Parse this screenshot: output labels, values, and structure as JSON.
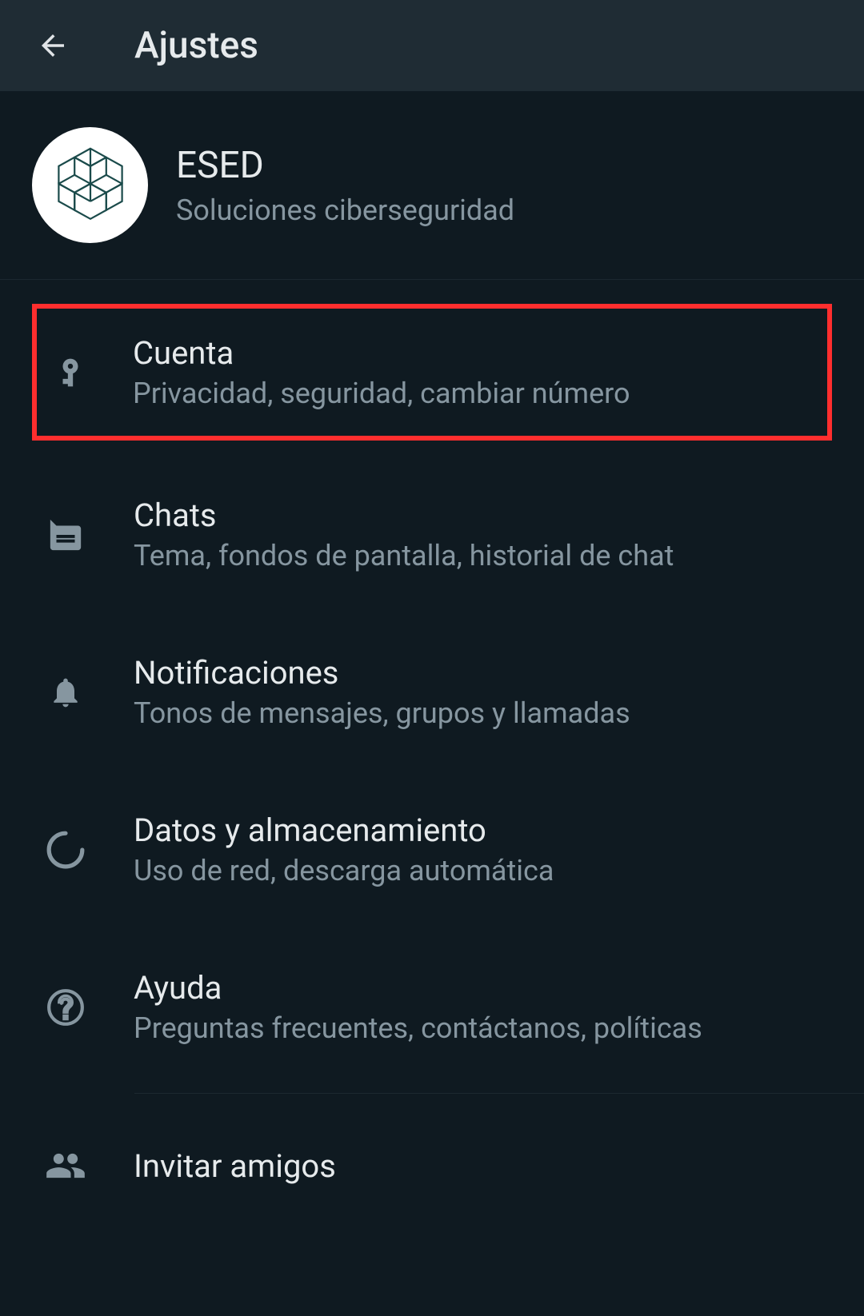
{
  "header": {
    "title": "Ajustes"
  },
  "profile": {
    "name": "ESED",
    "status": "Soluciones ciberseguridad"
  },
  "settings": [
    {
      "icon": "key-icon",
      "title": "Cuenta",
      "subtitle": "Privacidad, seguridad, cambiar número",
      "highlighted": true
    },
    {
      "icon": "chat-icon",
      "title": "Chats",
      "subtitle": "Tema, fondos de pantalla, historial de chat",
      "highlighted": false
    },
    {
      "icon": "bell-icon",
      "title": "Notificaciones",
      "subtitle": "Tonos de mensajes, grupos y llamadas",
      "highlighted": false
    },
    {
      "icon": "data-icon",
      "title": "Datos y almacenamiento",
      "subtitle": "Uso de red, descarga automática",
      "highlighted": false
    },
    {
      "icon": "help-icon",
      "title": "Ayuda",
      "subtitle": "Preguntas frecuentes, contáctanos, políticas",
      "highlighted": false
    }
  ],
  "invite": {
    "title": "Invitar amigos"
  }
}
